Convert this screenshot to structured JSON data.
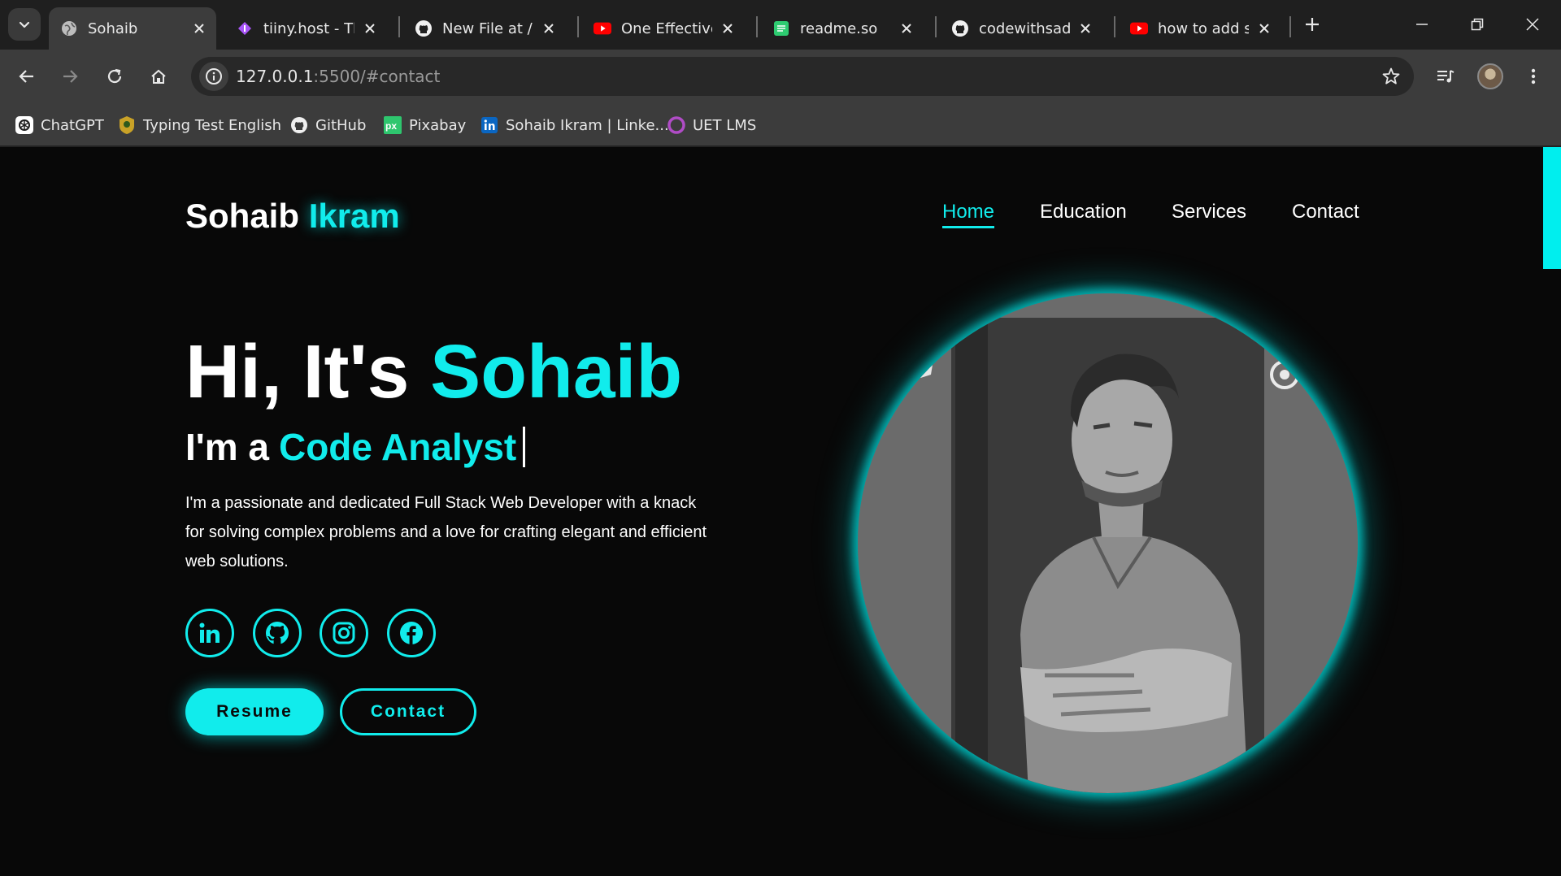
{
  "browser": {
    "tabs": [
      {
        "title": "Sohaib",
        "icon": "globe-icon",
        "active": true
      },
      {
        "title": "tiiny.host - Th",
        "icon": "tiiny-host-icon"
      },
      {
        "title": "New File at / ·",
        "icon": "github-icon"
      },
      {
        "title": "One Effective",
        "icon": "youtube-icon"
      },
      {
        "title": "readme.so",
        "icon": "readme-icon"
      },
      {
        "title": "codewithsade",
        "icon": "github-icon"
      },
      {
        "title": "how to add sc",
        "icon": "youtube-icon"
      }
    ],
    "url_host": "127.0.0.1",
    "url_rest": ":5500/#contact",
    "bookmarks": [
      {
        "label": "ChatGPT",
        "icon": "chatgpt-icon"
      },
      {
        "label": "Typing Test English",
        "icon": "typing-test-icon"
      },
      {
        "label": "GitHub",
        "icon": "github-icon"
      },
      {
        "label": "Pixabay",
        "icon": "pixabay-icon"
      },
      {
        "label": "Sohaib Ikram | Linke...",
        "icon": "linkedin-icon"
      },
      {
        "label": "UET LMS",
        "icon": "uet-lms-icon"
      }
    ]
  },
  "site": {
    "logo_first": "Sohaib",
    "logo_accent": "Ikram",
    "nav": [
      {
        "label": "Home",
        "active": true
      },
      {
        "label": "Education"
      },
      {
        "label": "Services"
      },
      {
        "label": "Contact"
      }
    ],
    "hero": {
      "greeting": "Hi, It's",
      "name": "Sohaib",
      "role_prefix": "I'm a",
      "role": "Code Analyst",
      "description": "I'm a passionate and dedicated Full Stack Web Developer with a knack for solving complex problems and a love for crafting elegant and efficient web solutions."
    },
    "social": [
      "linkedin-icon",
      "github-icon",
      "instagram-icon",
      "facebook-icon"
    ],
    "buttons": {
      "resume": "Resume",
      "contact": "Contact"
    }
  },
  "colors": {
    "accent": "#00eeee",
    "background": "#080808",
    "chrome": "#3c3c3c"
  }
}
